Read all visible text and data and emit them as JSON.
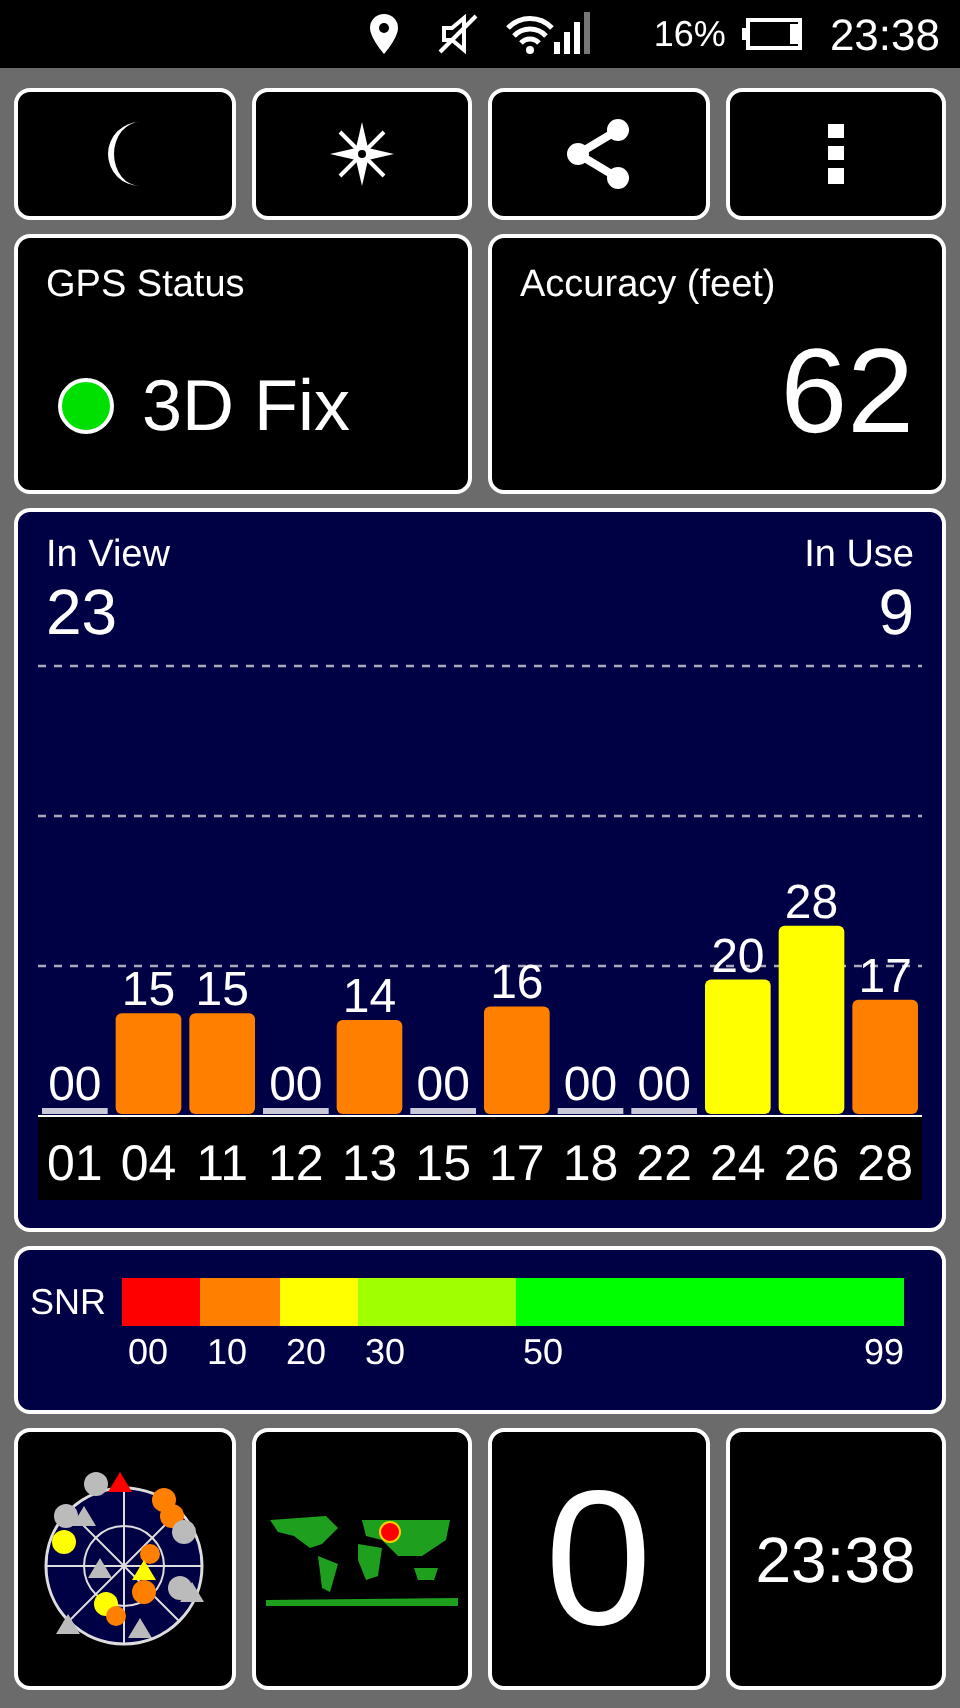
{
  "status_bar": {
    "battery": "16%",
    "time": "23:38"
  },
  "gps_status": {
    "label": "GPS Status",
    "fix": "3D Fix"
  },
  "accuracy": {
    "label": "Accuracy (feet)",
    "value": "62"
  },
  "satellites": {
    "in_view_label": "In View",
    "in_view": "23",
    "in_use_label": "In Use",
    "in_use": "9",
    "chart_data": {
      "type": "bar",
      "categories": [
        "01",
        "04",
        "11",
        "12",
        "13",
        "15",
        "17",
        "18",
        "22",
        "24",
        "26",
        "28"
      ],
      "values": [
        0,
        15,
        15,
        0,
        14,
        0,
        16,
        0,
        0,
        20,
        28,
        17
      ],
      "value_labels": [
        "00",
        "15",
        "15",
        "00",
        "14",
        "00",
        "16",
        "00",
        "00",
        "20",
        "28",
        "17"
      ]
    }
  },
  "snr_scale": {
    "label": "SNR",
    "segments": [
      {
        "color": "#ff0000"
      },
      {
        "color": "#ff8000"
      },
      {
        "color": "#ffff00"
      },
      {
        "color": "#a0ff00"
      },
      {
        "color": "#00ff00"
      }
    ],
    "ticks": [
      "00",
      "10",
      "20",
      "30",
      "50",
      "99"
    ]
  },
  "bottom_tiles": {
    "column_3": "0",
    "clock": "23:38"
  }
}
